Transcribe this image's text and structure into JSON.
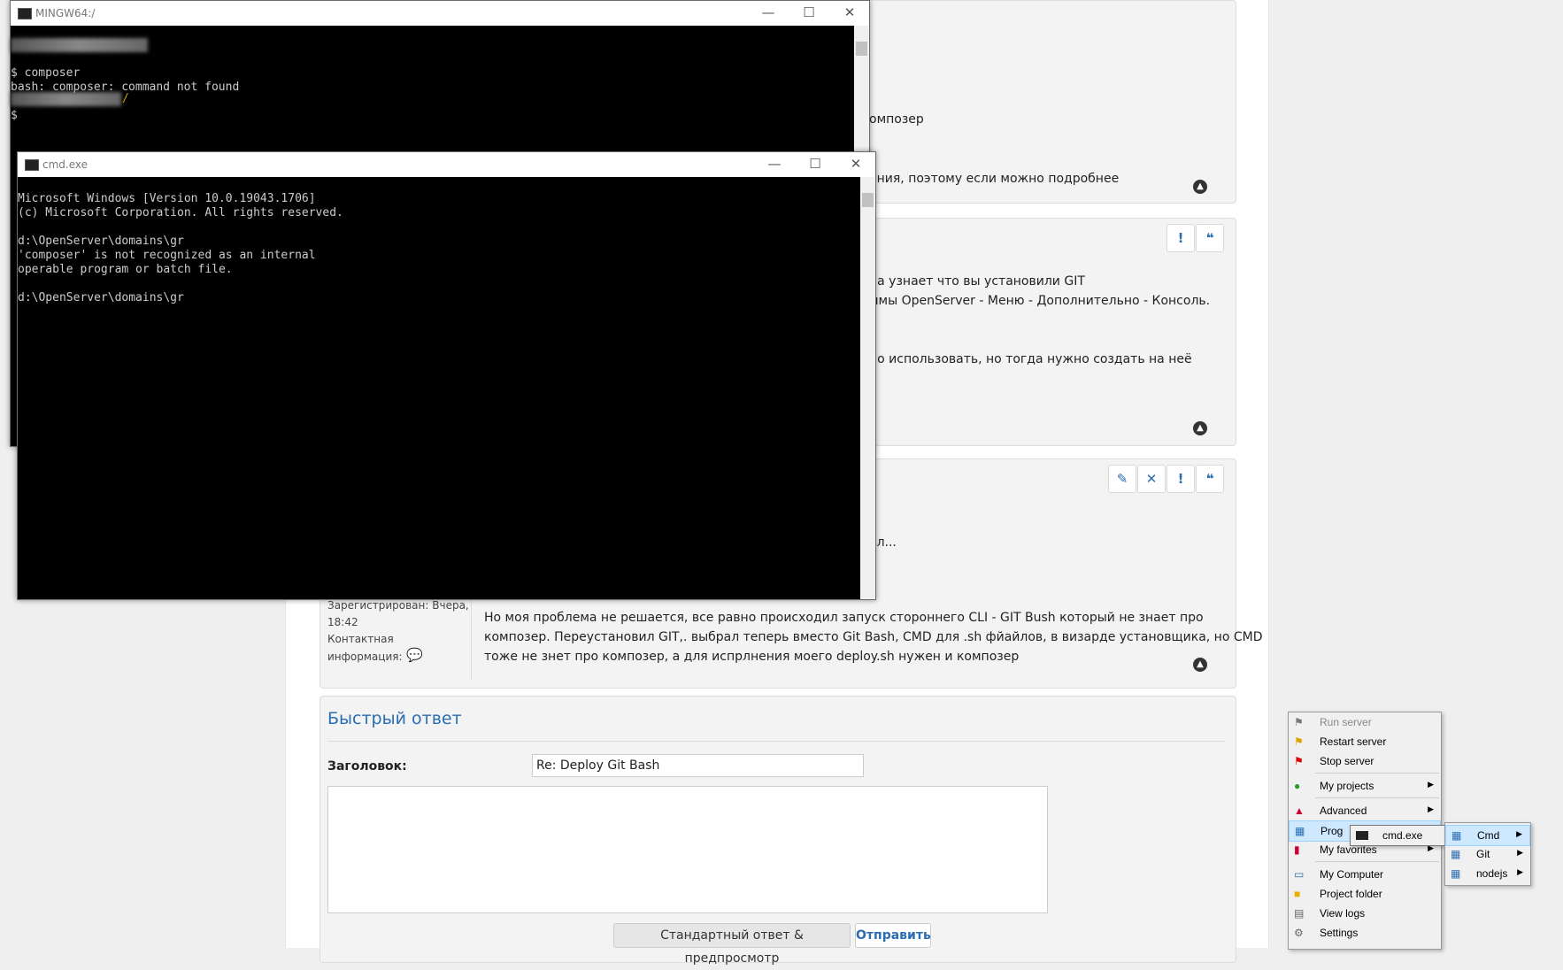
{
  "forum": {
    "post1_line1": "омпозер",
    "post1_line2": "ения, поэтому если можно подробнее",
    "post2_line1": "на узнает что вы установили GIT",
    "post2_line2": "ммы OpenServer - Меню - Дополнительно - Консоль.",
    "post2_line3": "но использовать, но тогда нужно создать на неё",
    "post2_line4": "..",
    "post3_line1": "ал...",
    "post3_text1": "Но моя проблема не решается, все равно происходил запуск стороннего CLI - GIT Bush который не знает про",
    "post3_text2": "композер. Переустановил GIT,. выбрал теперь вместо Git Bash, CMD для .sh фйайлов, в визарде установщика, но CMD",
    "post3_text3": "тоже не знет про композер, а для испрлнения моего deploy.sh нужен и композер",
    "registered": "Зарегистрирован: Вчера,",
    "registered_time": "18:42",
    "contact": "Контактная",
    "contact2": "информация:",
    "quick_reply_title": "Быстрый ответ",
    "subject_label": "Заголовок:",
    "subject_value": "Re: Deploy Git Bash",
    "btn_preview": "Стандартный ответ & предпросмотр",
    "btn_send": "Отправить"
  },
  "mingw": {
    "title": "MINGW64:/",
    "line1": "$ composer",
    "line2": "bash: composer: command not found",
    "line3": "/",
    "line4": "$"
  },
  "cmd": {
    "title": "cmd.exe",
    "line1": "Microsoft Windows [Version 10.0.19043.1706]",
    "line2": "(c) Microsoft Corporation. All rights reserved.",
    "line3": "d:\\OpenServer\\domains\\gr",
    "line4": "'composer' is not recognized as an internal",
    "line5": "operable program or batch file.",
    "line6": "d:\\OpenServer\\domains\\gr"
  },
  "tray_menu": {
    "run_server": "Run server",
    "restart_server": "Restart server",
    "stop_server": "Stop server",
    "my_projects": "My projects",
    "advanced": "Advanced",
    "programs": "Prog",
    "my_favorites": "My favorites",
    "my_computer": "My Computer",
    "project_folder": "Project folder",
    "view_logs": "View logs",
    "settings": "Settings"
  },
  "submenu": {
    "cmd": "Cmd",
    "git": "Git",
    "nodejs": "nodejs",
    "cmd_exe": "cmd.exe"
  },
  "colors": {
    "accent": "#2a6db0",
    "menu_highlight": "#cde8ff"
  }
}
